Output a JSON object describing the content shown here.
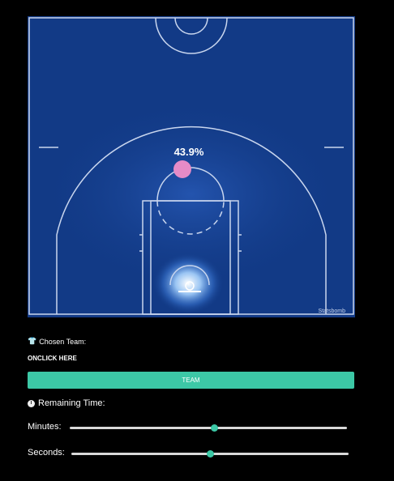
{
  "court": {
    "percentage": "43.9%",
    "watermark": "Statsbomb"
  },
  "chosen_team": {
    "icon": "shirt-icon",
    "label": "Chosen Team:"
  },
  "onclick_text": "ONCLICK HERE",
  "team_button": {
    "label": "TEAM"
  },
  "remaining_time": {
    "icon": "clock-icon",
    "label": "Remaining Time:"
  },
  "sliders": {
    "minutes": {
      "label": "Minutes:",
      "value_fraction": 0.52
    },
    "seconds": {
      "label": "Seconds:",
      "value_fraction": 0.5
    }
  },
  "colors": {
    "court": "#123a86",
    "accent": "#3cc8a6",
    "marker": "#e58bc7"
  }
}
